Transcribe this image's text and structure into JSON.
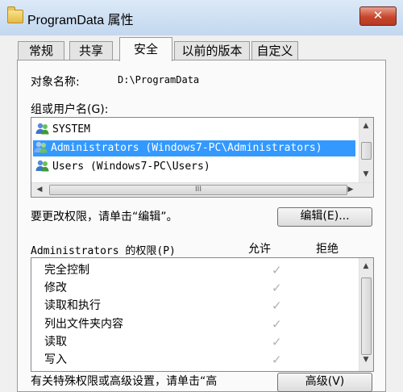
{
  "window": {
    "title": "ProgramData 属性",
    "close_label": "✕"
  },
  "tabs": [
    {
      "label": "常规"
    },
    {
      "label": "共享"
    },
    {
      "label": "安全",
      "active": true
    },
    {
      "label": "以前的版本"
    },
    {
      "label": "自定义"
    }
  ],
  "object": {
    "label": "对象名称:",
    "value": "D:\\ProgramData"
  },
  "groups": {
    "label": "组或用户名(G):",
    "items": [
      {
        "label": "SYSTEM",
        "icon": "user-group-icon"
      },
      {
        "label": "Administrators (Windows7-PC\\Administrators)",
        "icon": "user-group-icon",
        "selected": true
      },
      {
        "label": "Users (Windows7-PC\\Users)",
        "icon": "user-group-icon"
      }
    ],
    "hscroll_grip": "III"
  },
  "edit": {
    "hint": "要更改权限，请单击“编辑”。",
    "button_label": "编辑(E)..."
  },
  "permissions": {
    "label": "Administrators 的权限(P)",
    "allow_header": "允许",
    "deny_header": "拒绝",
    "rows": [
      {
        "name": "完全控制",
        "allow_mark": "✓"
      },
      {
        "name": "修改",
        "allow_mark": "✓"
      },
      {
        "name": "读取和执行",
        "allow_mark": "✓"
      },
      {
        "name": "列出文件夹内容",
        "allow_mark": "✓"
      },
      {
        "name": "读取",
        "allow_mark": "✓"
      },
      {
        "name": "写入",
        "allow_mark": "✓"
      }
    ]
  },
  "advanced": {
    "hint": "有关特殊权限或高级设置，请单击“高",
    "button_label": "高级(V)"
  },
  "colors": {
    "selection": "#3399ff",
    "close_button": "#c7462c"
  }
}
